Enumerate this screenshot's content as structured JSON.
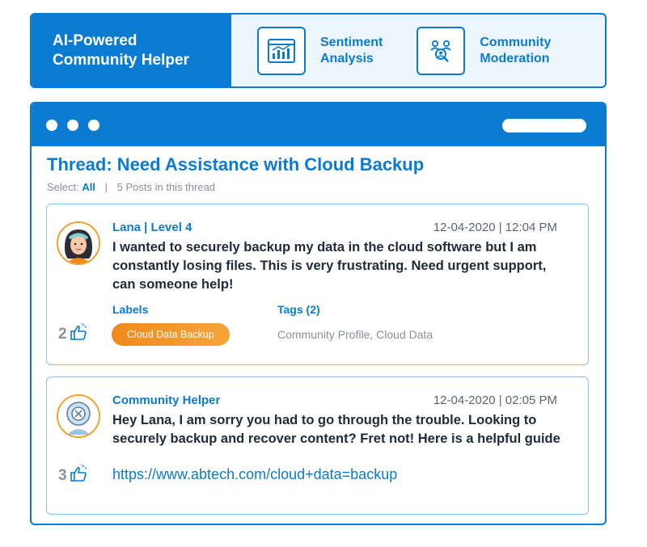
{
  "header": {
    "brand": "AI-Powered\nCommunity Helper",
    "features": [
      {
        "label": "Sentiment\nAnalysis",
        "icon": "analytics-chart-icon"
      },
      {
        "label": "Community\nModeration",
        "icon": "moderation-users-icon"
      }
    ]
  },
  "thread": {
    "title": "Thread: Need Assistance with Cloud Backup",
    "select_label": "Select:",
    "select_value": "All",
    "separator": "|",
    "post_count": "5 Posts in this thread"
  },
  "posts": [
    {
      "author": "Lana | Level 4",
      "date": "12-04-2020",
      "time": "| 12:04 PM",
      "text": "I wanted to securely backup my data in the cloud software but I am constantly losing files. This is very frustrating. Need urgent support, can someone help!",
      "likes": "2",
      "labels_heading": "Labels",
      "label": "Cloud Data Backup",
      "tags_heading": "Tags (2)",
      "tags": "Community Profile, Cloud Data"
    },
    {
      "author": "Community Helper",
      "date": "12-04-2020",
      "time": "| 02:05 PM",
      "text": "Hey Lana, I am sorry you had to go through the trouble. Looking to securely backup and recover content? Fret not! Here is a helpful guide",
      "likes": "3",
      "link": "https://www.abtech.com/cloud+data=backup"
    }
  ],
  "colors": {
    "accent": "#0b7ad1",
    "label_chip": "#f08a1c",
    "avatar_ring": "#f0a030"
  }
}
